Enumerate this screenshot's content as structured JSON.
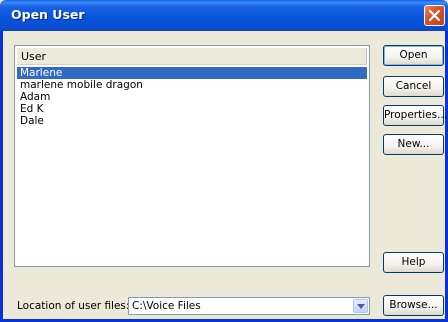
{
  "window": {
    "title": "Open User"
  },
  "list": {
    "header": "User",
    "items": [
      "Marlene",
      "marlene mobile dragon",
      "Adam",
      "Ed K",
      "Dale"
    ],
    "selected_index": 0
  },
  "buttons": {
    "open": "Open",
    "cancel": "Cancel",
    "properties": "Properties...",
    "new": "New...",
    "help": "Help",
    "browse": "Browse..."
  },
  "location": {
    "label": "Location of user files:",
    "value": "C:\\Voice Files"
  },
  "icons": {
    "close": "close-icon",
    "dropdown": "chevron-down-icon"
  },
  "colors": {
    "titlebar": "#0855dd",
    "selection": "#316ac5",
    "close": "#d8542f"
  }
}
